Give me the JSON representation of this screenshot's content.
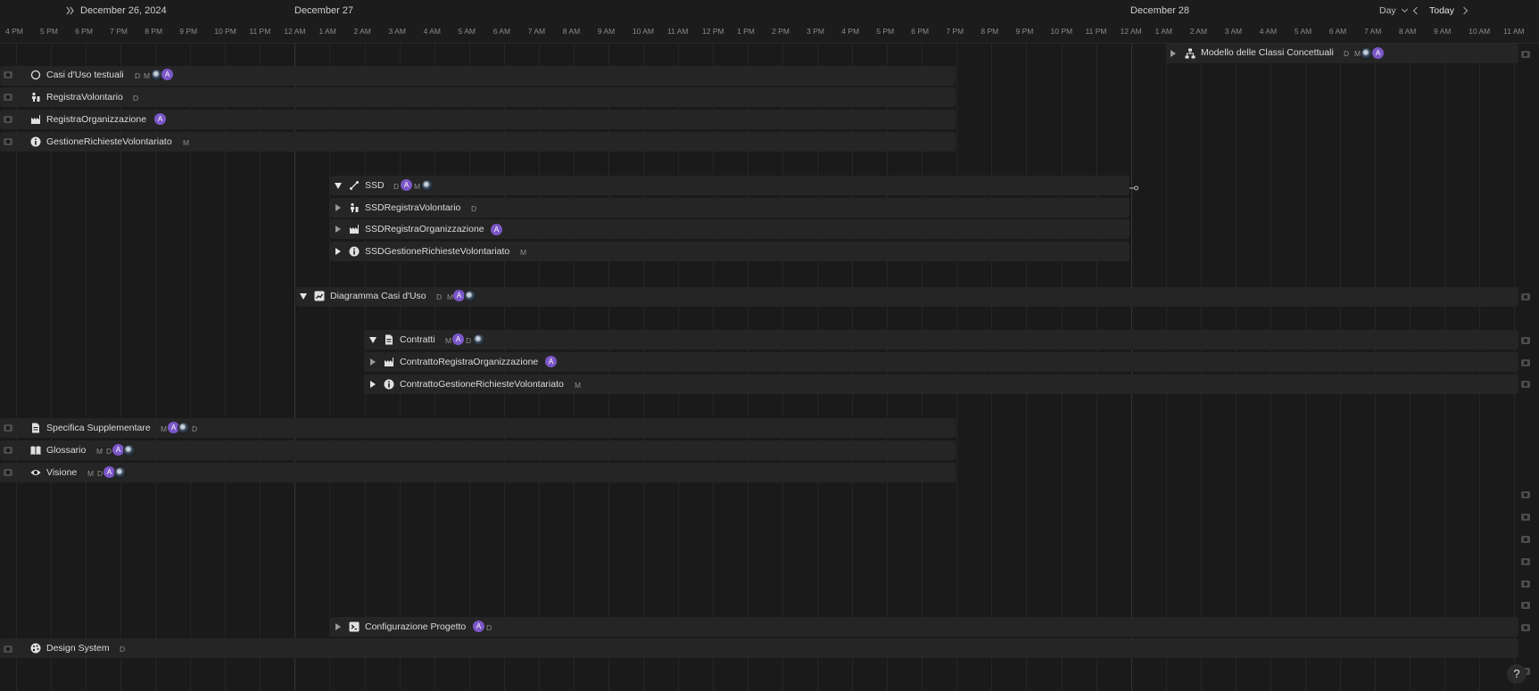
{
  "header": {
    "dates": [
      {
        "label": "December 26, 2024"
      },
      {
        "label": "December 27"
      },
      {
        "label": "December 28"
      }
    ],
    "hours": [
      "4 PM",
      "5 PM",
      "6 PM",
      "7 PM",
      "8 PM",
      "9 PM",
      "10 PM",
      "11 PM",
      "12 AM",
      "1 AM",
      "2 AM",
      "3 AM",
      "4 AM",
      "5 AM",
      "6 AM",
      "7 AM",
      "8 AM",
      "9 AM",
      "10 AM",
      "11 AM",
      "12 PM",
      "1 PM",
      "2 PM",
      "3 PM",
      "4 PM",
      "5 PM",
      "6 PM",
      "7 PM",
      "8 PM",
      "9 PM",
      "10 PM",
      "11 PM",
      "12 AM",
      "1 AM",
      "2 AM",
      "3 AM",
      "4 AM",
      "5 AM",
      "6 AM",
      "7 AM",
      "8 AM",
      "9 AM",
      "10 AM",
      "11 AM"
    ],
    "view_label": "Day",
    "today_label": "Today"
  },
  "rows": {
    "casi_uso": {
      "label": "Casi d'Uso testuali",
      "tags": [
        "D",
        "M"
      ]
    },
    "registra_volontario": {
      "label": "RegistraVolontario",
      "tags": [
        "D"
      ]
    },
    "registra_organizzazione": {
      "label": "RegistraOrganizzazione",
      "tags": []
    },
    "gestione_richieste": {
      "label": "GestioneRichiesteVolontariato",
      "tags": [
        "M"
      ]
    },
    "ssd": {
      "label": "SSD",
      "tags": [
        "D",
        "M"
      ]
    },
    "ssd_registra_volontario": {
      "label": "SSDRegistraVolontario",
      "tags": [
        "D"
      ]
    },
    "ssd_registra_organizzazione": {
      "label": "SSDRegistraOrganizzazione",
      "tags": []
    },
    "ssd_gestione": {
      "label": "SSDGestioneRichiesteVolontariato",
      "tags": [
        "M"
      ]
    },
    "diagramma_casi": {
      "label": "Diagramma Casi d'Uso",
      "tags": [
        "D",
        "M"
      ]
    },
    "contratti": {
      "label": "Contratti",
      "tags": [
        "M",
        "D"
      ]
    },
    "contratto_registra_org": {
      "label": "ContrattoRegistraOrganizzazione",
      "tags": []
    },
    "contratto_gestione": {
      "label": "ContrattoGestioneRichiesteVolontariato",
      "tags": [
        "M"
      ]
    },
    "specifica": {
      "label": "Specifica Supplementare",
      "tags": [
        "M",
        "D"
      ]
    },
    "glossario": {
      "label": "Glossario",
      "tags": [
        "M",
        "D"
      ]
    },
    "visione": {
      "label": "Visione",
      "tags": [
        "M",
        "D"
      ]
    },
    "configurazione": {
      "label": "Configurazione Progetto",
      "tags": [
        "D"
      ]
    },
    "design_system": {
      "label": "Design System",
      "tags": [
        "D"
      ]
    },
    "modello_classi": {
      "label": "Modello delle Classi Concettuali",
      "tags": [
        "D",
        "M"
      ]
    }
  },
  "avatar_letter": "A",
  "help_label": "?",
  "colors": {
    "background": "#1a1a1a",
    "bar": "#252525",
    "avatar": "#7b57c7"
  }
}
